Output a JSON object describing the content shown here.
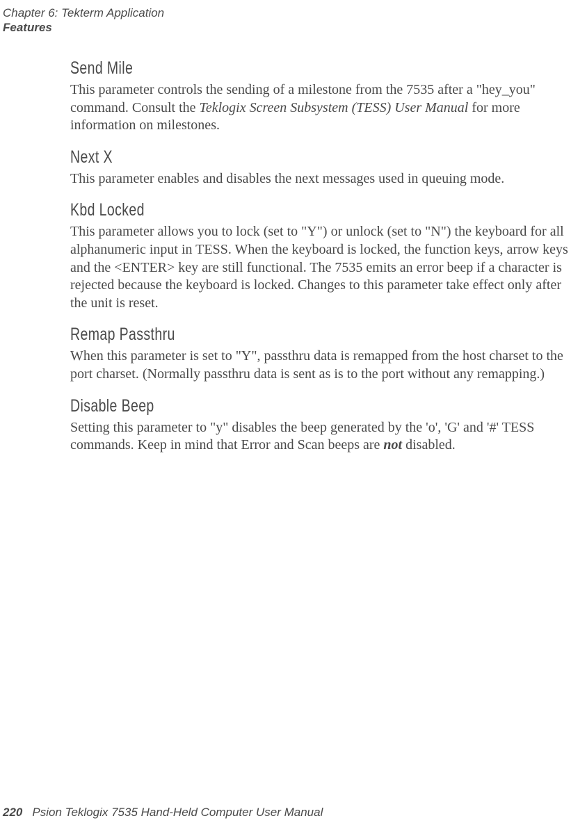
{
  "header": {
    "chapter_line": "Chapter 6: Tekterm Application",
    "section_line": "Features"
  },
  "sections": {
    "send_mile": {
      "heading": "Send Mile",
      "p1a": "This parameter controls the sending of a milestone from the 7535 after a \"hey_you\" command. Consult the ",
      "p1_ital": "Teklogix Screen Subsystem (TESS) User Manual",
      "p1b": " for more information on milestones."
    },
    "next_x": {
      "heading": "Next X",
      "p1": "This parameter enables and disables the next messages used in queuing mode."
    },
    "kbd_locked": {
      "heading": "Kbd Locked",
      "p1": "This parameter allows you to lock (set to \"Y\") or unlock (set to \"N\") the keyboard for all alphanumeric input in TESS. When the keyboard is locked, the function keys, arrow keys and the <ENTER> key are still functional. The 7535 emits an error beep if a character is rejected because the keyboard is locked. Changes to this parameter take effect only after the unit is reset."
    },
    "remap_passthru": {
      "heading": "Remap Passthru",
      "p1": "When this parameter is set to \"Y\", passthru data is remapped from the host charset to the port charset. (Normally passthru data is sent as is to the port without any remapping.)"
    },
    "disable_beep": {
      "heading": "Disable Beep",
      "p1a": "Setting this parameter to \"y\" disables the beep generated by the 'o', 'G' and '#' TESS commands. Keep in mind that Error and Scan beeps are ",
      "p1_bold": "not",
      "p1b": " disabled."
    }
  },
  "footer": {
    "page_number": "220",
    "manual_title": "Psion Teklogix 7535 Hand-Held Computer User Manual"
  }
}
